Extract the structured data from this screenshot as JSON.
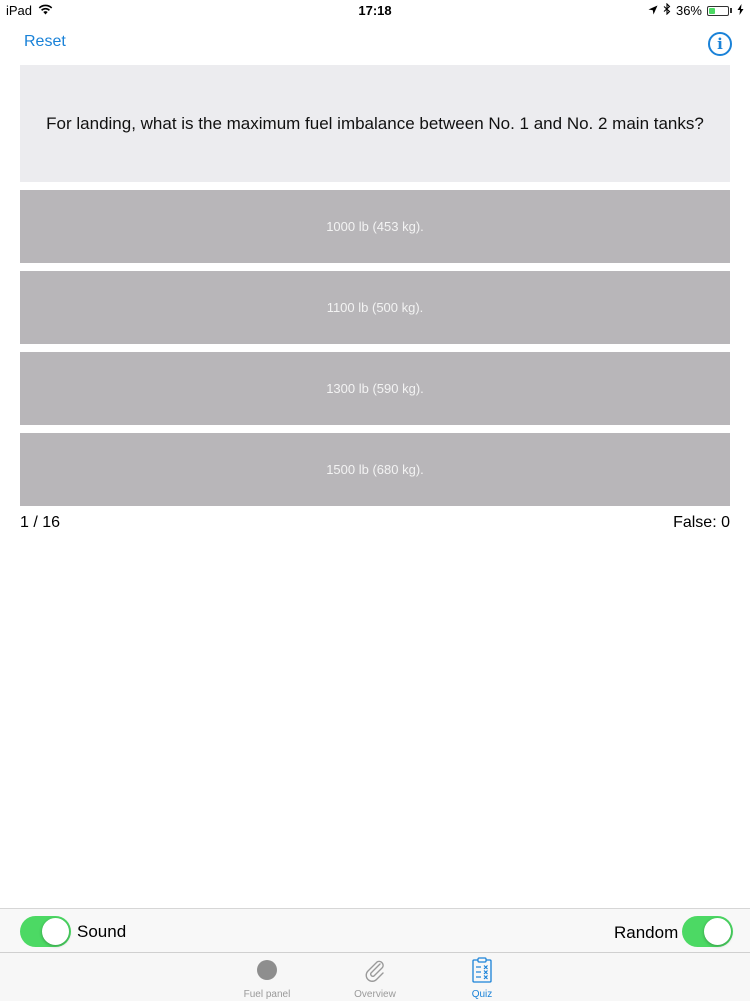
{
  "status_bar": {
    "device": "iPad",
    "time": "17:18",
    "battery": "36%",
    "battery_level": 0.36
  },
  "nav": {
    "reset_label": "Reset",
    "info_glyph": "i"
  },
  "quiz": {
    "question": "For landing, what is the maximum fuel imbalance between No. 1 and No. 2 main tanks?",
    "answers": [
      "1000 lb (453 kg).",
      "1100 lb (500 kg).",
      "1300 lb (590 kg).",
      "1500 lb (680 kg)."
    ],
    "progress": "1 / 16",
    "false_count": "False: 0"
  },
  "toolbar": {
    "sound_label": "Sound",
    "sound_on": true,
    "random_label": "Random",
    "random_on": true
  },
  "tabs": [
    {
      "label": "Fuel panel",
      "icon": "circle-icon",
      "active": false
    },
    {
      "label": "Overview",
      "icon": "paperclip-icon",
      "active": false
    },
    {
      "label": "Quiz",
      "icon": "clipboard-icon",
      "active": true
    }
  ],
  "colors": {
    "accent": "#1a82d8",
    "toggle_on": "#4cd964",
    "answer_bg": "#b8b6b9",
    "question_bg": "#ececef"
  }
}
